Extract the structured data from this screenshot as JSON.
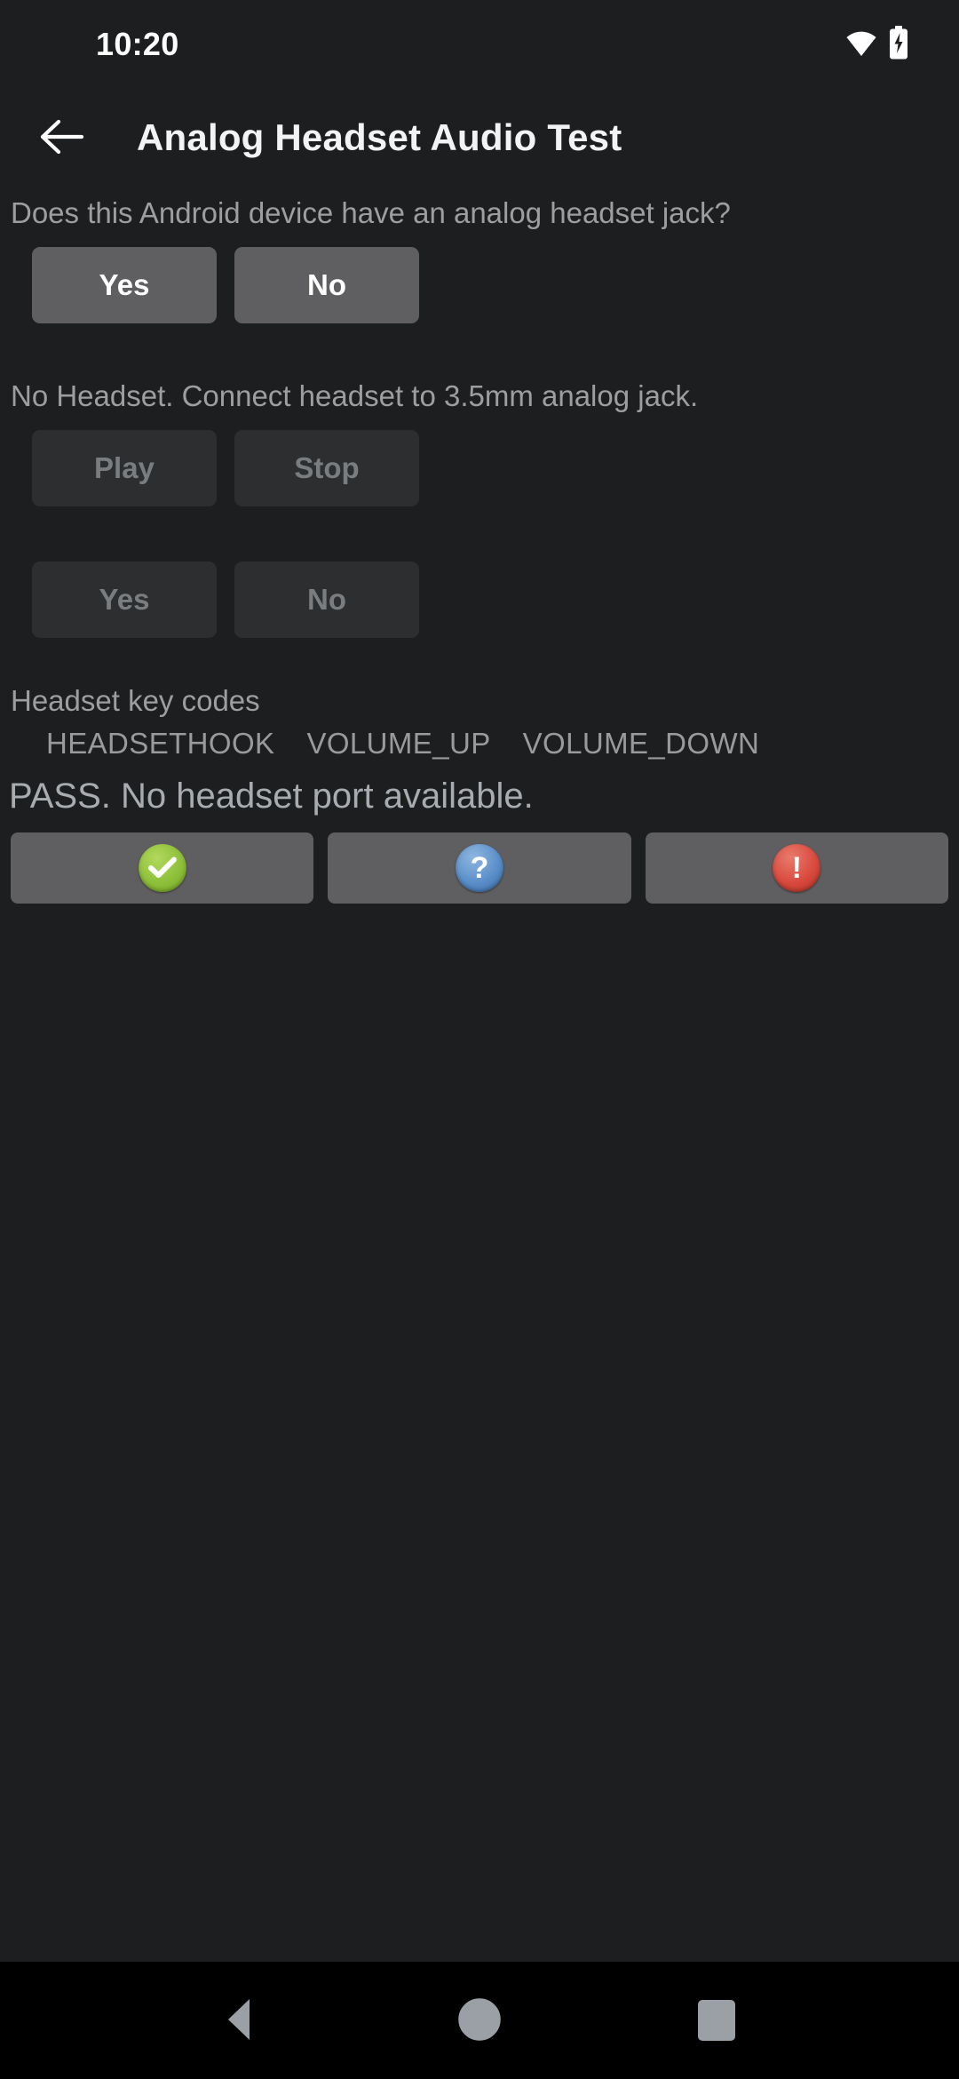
{
  "status_bar": {
    "clock": "10:20",
    "wifi_icon": "wifi-icon",
    "battery_icon": "battery-charging-icon"
  },
  "app_bar": {
    "back_icon": "back-arrow-icon",
    "title": "Analog Headset Audio Test"
  },
  "sections": {
    "jack_question": {
      "prompt": "Does this Android device have an analog headset jack?",
      "yes_label": "Yes",
      "no_label": "No",
      "enabled": true
    },
    "playback": {
      "prompt": "No Headset. Connect headset to 3.5mm analog jack.",
      "play_label": "Play",
      "stop_label": "Stop",
      "enabled": false
    },
    "heard_question": {
      "yes_label": "Yes",
      "no_label": "No",
      "enabled": false
    },
    "key_codes": {
      "label": "Headset key codes",
      "codes": [
        "HEADSETHOOK",
        "VOLUME_UP",
        "VOLUME_DOWN"
      ]
    },
    "result": {
      "text": "PASS. No headset port available."
    }
  },
  "verdict_buttons": [
    {
      "name": "pass-button",
      "icon": "check-circle-icon",
      "glyph": "✓",
      "color": "#8ec03a"
    },
    {
      "name": "info-button",
      "icon": "question-circle-icon",
      "glyph": "?",
      "color": "#5b8fc9"
    },
    {
      "name": "fail-button",
      "icon": "exclamation-circle-icon",
      "glyph": "!",
      "color": "#d94a3e"
    }
  ],
  "nav_bar": {
    "back_label": "back-triangle-icon",
    "home_label": "home-circle-icon",
    "recents_label": "recents-square-icon"
  },
  "theme": {
    "background": "#1c1e20",
    "nav_background": "#000000",
    "button_enabled": "#5f5f62",
    "button_disabled": "#2c2e30",
    "text_primary": "#ffffff",
    "text_secondary": "#9e9e9e"
  }
}
